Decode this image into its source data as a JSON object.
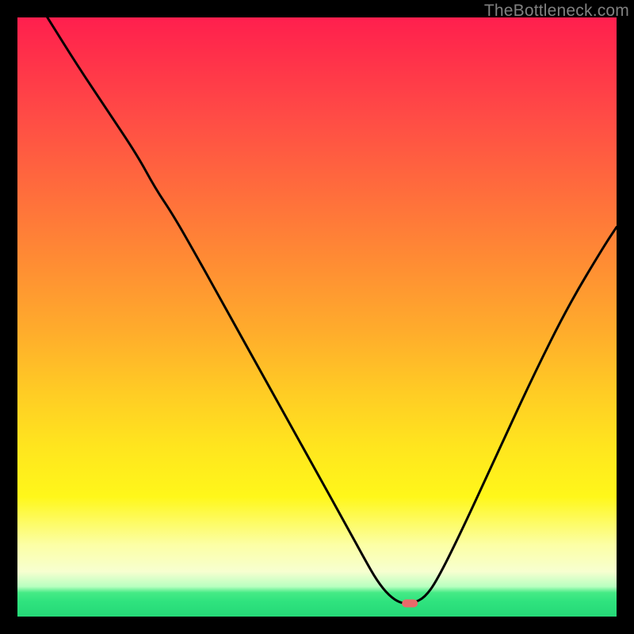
{
  "watermark": "TheBottleneck.com",
  "colors": {
    "background": "#000000",
    "watermark_text": "#808080",
    "curve": "#000000",
    "marker": "#e96a6a",
    "gradient_top": "#ff1f4e",
    "gradient_bottom": "#25d877"
  },
  "chart_data": {
    "type": "line",
    "title": "",
    "xlabel": "",
    "ylabel": "",
    "xlim": [
      0,
      100
    ],
    "ylim": [
      0,
      100
    ],
    "grid": false,
    "legend": false,
    "notes": "No axis ticks or labels are rendered; x and y are expressed as 0–100 percent of the plot area. The curve starts near the top-left, descends to a flat minimum around x≈62–67%, then rises to the right edge. A small pill-shaped marker sits on the flat minimum.",
    "series": [
      {
        "name": "curve",
        "x": [
          5,
          10,
          15,
          20,
          23,
          26,
          30,
          35,
          40,
          45,
          50,
          55,
          58,
          60,
          62,
          64,
          66,
          68,
          70,
          74,
          80,
          86,
          92,
          98,
          100
        ],
        "y": [
          100,
          92,
          84.5,
          77,
          71.5,
          67,
          60,
          51,
          42,
          33,
          24,
          15,
          9.5,
          6,
          3.5,
          2.2,
          2.2,
          3.2,
          6,
          14,
          27,
          40,
          52,
          62,
          65
        ]
      }
    ],
    "marker": {
      "x": 65.5,
      "y": 2.2,
      "shape": "pill"
    },
    "background_gradient": {
      "direction": "vertical",
      "meaning": "red (high bottleneck) → green (optimal)",
      "stops": [
        {
          "pct": 0,
          "color": "#ff1f4e"
        },
        {
          "pct": 40,
          "color": "#ff8a34"
        },
        {
          "pct": 72,
          "color": "#ffe61e"
        },
        {
          "pct": 92,
          "color": "#f7ffd0"
        },
        {
          "pct": 96,
          "color": "#46ea86"
        },
        {
          "pct": 100,
          "color": "#25d877"
        }
      ]
    }
  }
}
